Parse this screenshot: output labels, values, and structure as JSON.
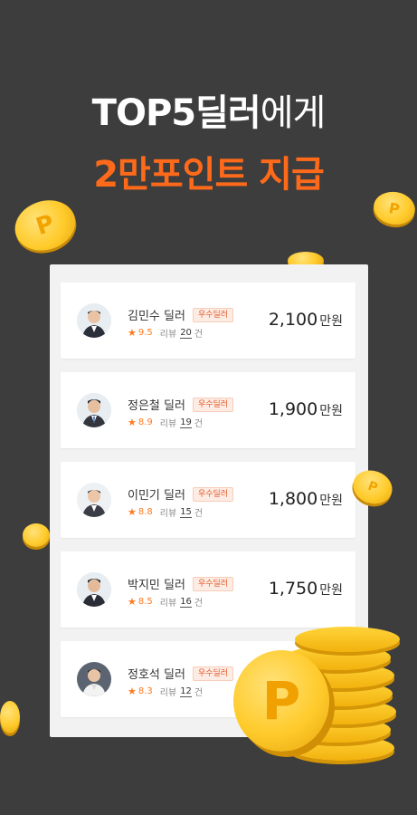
{
  "headline": {
    "line1_bold": "TOP5딜러",
    "line1_rest": "에게",
    "line2": "2만포인트 지급"
  },
  "colors": {
    "background": "#3d3d3d",
    "accent": "#ff6a1a",
    "star": "#ff7a1f",
    "coin": "#ffcb2c"
  },
  "coin_symbol": "P",
  "dealers": [
    {
      "name": "김민수 딜러",
      "badge": "우수딜러",
      "rating": "9.5",
      "review_label": "리뷰",
      "reviews": "20",
      "reviews_unit": "건",
      "amount": "2,100",
      "unit": "만원"
    },
    {
      "name": "정은철 딜러",
      "badge": "우수딜러",
      "rating": "8.9",
      "review_label": "리뷰",
      "reviews": "19",
      "reviews_unit": "건",
      "amount": "1,900",
      "unit": "만원"
    },
    {
      "name": "이민기 딜러",
      "badge": "우수딜러",
      "rating": "8.8",
      "review_label": "리뷰",
      "reviews": "15",
      "reviews_unit": "건",
      "amount": "1,800",
      "unit": "만원"
    },
    {
      "name": "박지민 딜러",
      "badge": "우수딜러",
      "rating": "8.5",
      "review_label": "리뷰",
      "reviews": "16",
      "reviews_unit": "건",
      "amount": "1,750",
      "unit": "만원"
    },
    {
      "name": "정호석 딜러",
      "badge": "우수딜러",
      "rating": "8.3",
      "review_label": "리뷰",
      "reviews": "12",
      "reviews_unit": "건",
      "amount": "",
      "unit": ""
    }
  ]
}
